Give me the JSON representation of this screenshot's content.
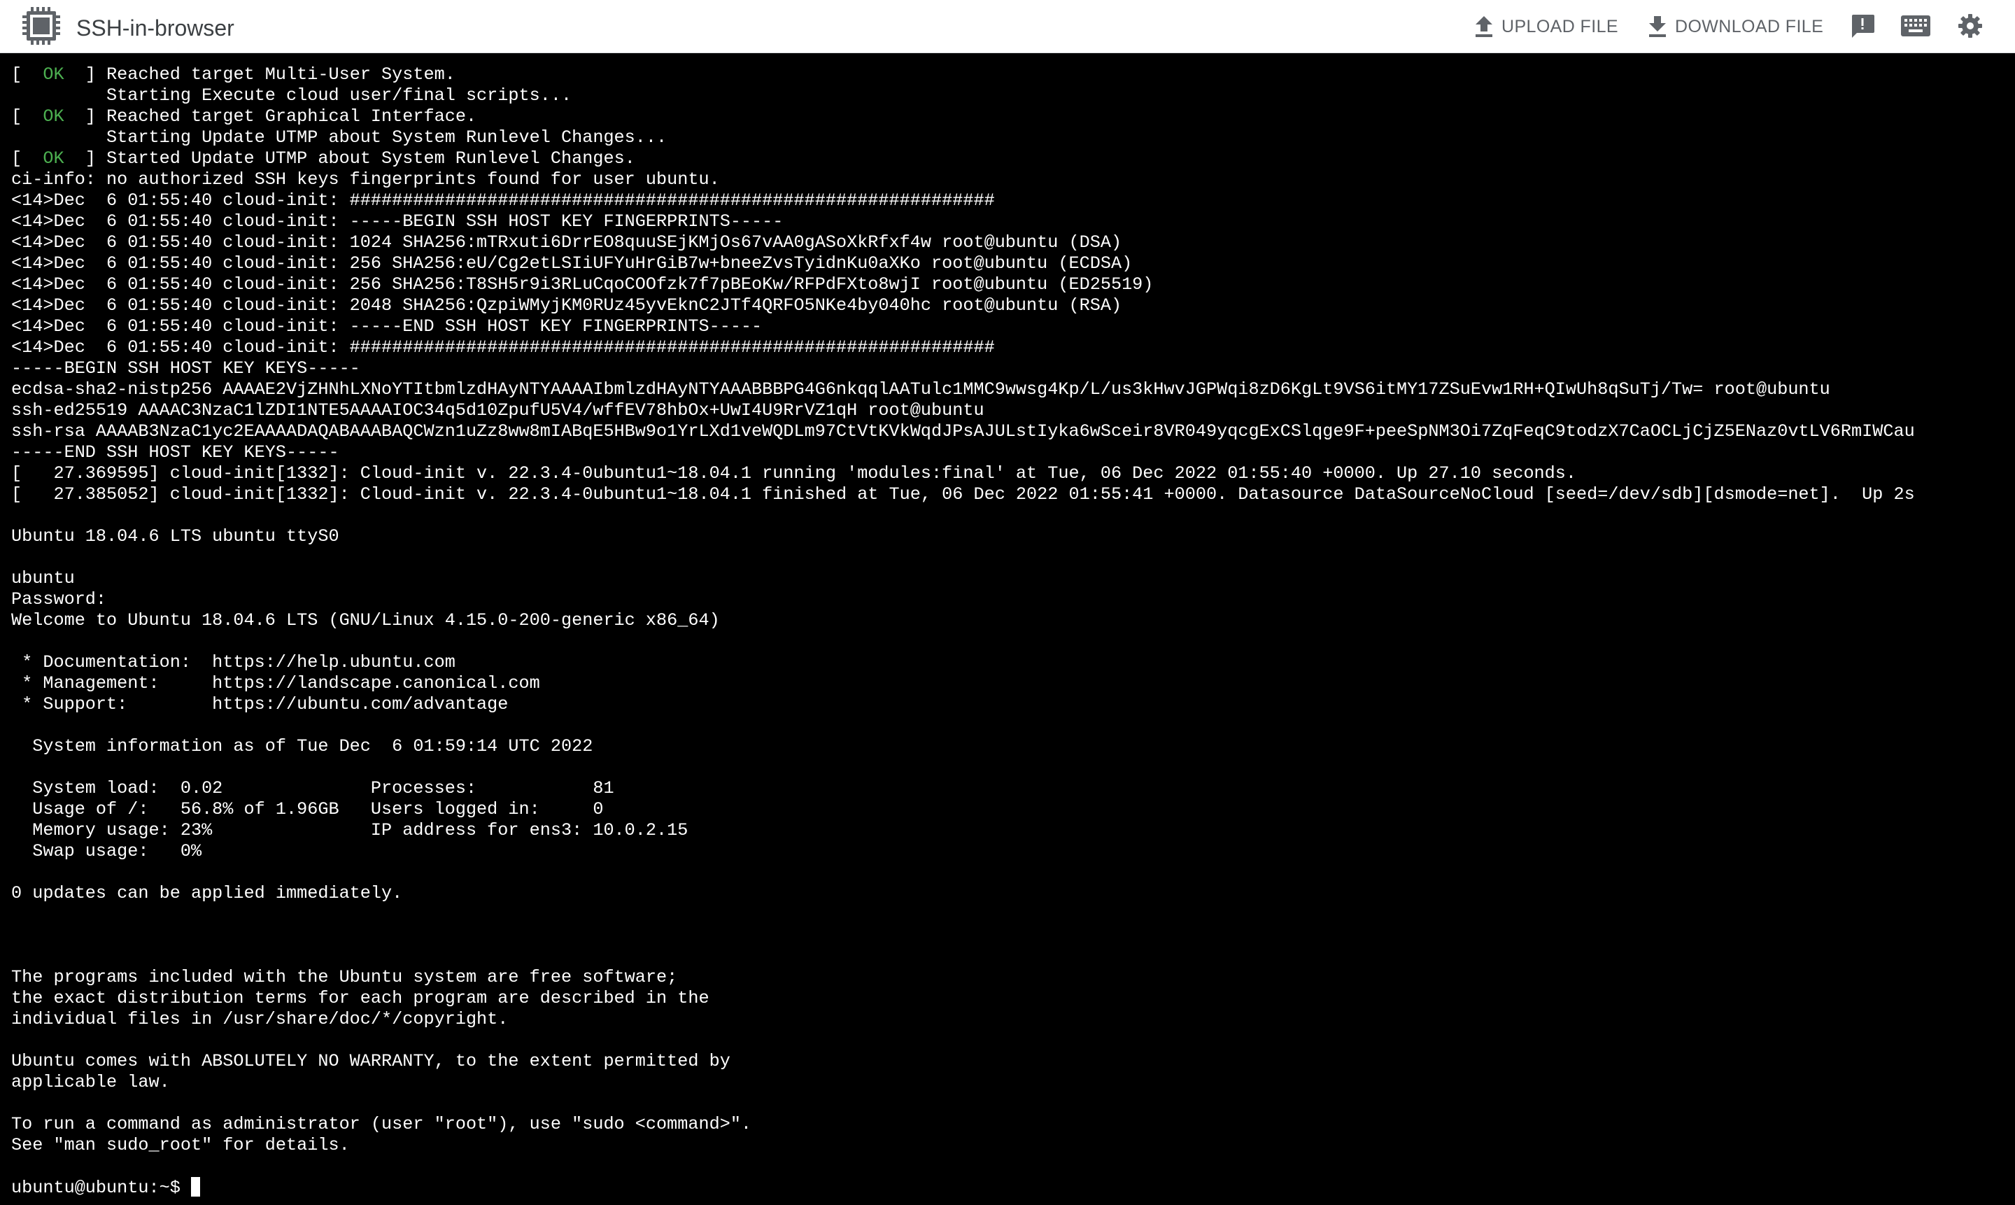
{
  "app": {
    "title": "SSH-in-browser"
  },
  "toolbar": {
    "upload_label": "UPLOAD FILE",
    "download_label": "DOWNLOAD FILE",
    "icons": {
      "logo": "chip-icon",
      "upload": "upload-icon",
      "download": "download-icon",
      "feedback": "feedback-icon",
      "keyboard": "keyboard-icon",
      "settings": "gear-icon"
    }
  },
  "colors": {
    "terminal_background": "#000000",
    "terminal_text": "#ffffff",
    "ok_status": "#4caf50",
    "toolbar_background": "#ffffff",
    "toolbar_text": "#5f6368"
  },
  "terminal": {
    "lines": [
      {
        "ok": true,
        "text": "Reached target Multi-User System."
      },
      {
        "text": "         Starting Execute cloud user/final scripts..."
      },
      {
        "ok": true,
        "text": "Reached target Graphical Interface."
      },
      {
        "text": "         Starting Update UTMP about System Runlevel Changes..."
      },
      {
        "ok": true,
        "text": "Started Update UTMP about System Runlevel Changes."
      },
      {
        "text": "ci-info: no authorized SSH keys fingerprints found for user ubuntu."
      },
      {
        "text": "<14>Dec  6 01:55:40 cloud-init: #############################################################"
      },
      {
        "text": "<14>Dec  6 01:55:40 cloud-init: -----BEGIN SSH HOST KEY FINGERPRINTS-----"
      },
      {
        "text": "<14>Dec  6 01:55:40 cloud-init: 1024 SHA256:mTRxuti6DrrEO8quuSEjKMjOs67vAA0gASoXkRfxf4w root@ubuntu (DSA)"
      },
      {
        "text": "<14>Dec  6 01:55:40 cloud-init: 256 SHA256:eU/Cg2etLSIiUFYuHrGiB7w+bneeZvsTyidnKu0aXKo root@ubuntu (ECDSA)"
      },
      {
        "text": "<14>Dec  6 01:55:40 cloud-init: 256 SHA256:T8SH5r9i3RLuCqoCOOfzk7f7pBEoKw/RFPdFXto8wjI root@ubuntu (ED25519)"
      },
      {
        "text": "<14>Dec  6 01:55:40 cloud-init: 2048 SHA256:QzpiWMyjKM0RUz45yvEknC2JTf4QRFO5NKe4by040hc root@ubuntu (RSA)"
      },
      {
        "text": "<14>Dec  6 01:55:40 cloud-init: -----END SSH HOST KEY FINGERPRINTS-----"
      },
      {
        "text": "<14>Dec  6 01:55:40 cloud-init: #############################################################"
      },
      {
        "text": "-----BEGIN SSH HOST KEY KEYS-----"
      },
      {
        "text": "ecdsa-sha2-nistp256 AAAAE2VjZHNhLXNoYTItbmlzdHAyNTYAAAAIbmlzdHAyNTYAAABBBPG4G6nkqqlAATulc1MMC9wwsg4Kp/L/us3kHwvJGPWqi8zD6KgLt9VS6itMY17ZSuEvw1RH+QIwUh8qSuTj/Tw= root@ubuntu"
      },
      {
        "text": "ssh-ed25519 AAAAC3NzaC1lZDI1NTE5AAAAIOC34q5d10ZpufU5V4/wffEV78hbOx+UwI4U9RrVZ1qH root@ubuntu"
      },
      {
        "text": "ssh-rsa AAAAB3NzaC1yc2EAAAADAQABAAABAQCWzn1uZz8ww8mIABqE5HBw9o1YrLXd1veWQDLm97CtVtKVkWqdJPsAJULstIyka6wSceir8VR049yqcgExCSlqge9F+peeSpNM3Oi7ZqFeqC9todzX7CaOCLjCjZ5ENaz0vtLV6RmIWCau"
      },
      {
        "text": "-----END SSH HOST KEY KEYS-----"
      },
      {
        "text": "[   27.369595] cloud-init[1332]: Cloud-init v. 22.3.4-0ubuntu1~18.04.1 running 'modules:final' at Tue, 06 Dec 2022 01:55:40 +0000. Up 27.10 seconds."
      },
      {
        "text": "[   27.385052] cloud-init[1332]: Cloud-init v. 22.3.4-0ubuntu1~18.04.1 finished at Tue, 06 Dec 2022 01:55:41 +0000. Datasource DataSourceNoCloud [seed=/dev/sdb][dsmode=net].  Up 2s"
      },
      {
        "text": ""
      },
      {
        "text": "Ubuntu 18.04.6 LTS ubuntu ttyS0"
      },
      {
        "text": ""
      },
      {
        "text": "ubuntu"
      },
      {
        "text": "Password:"
      },
      {
        "text": "Welcome to Ubuntu 18.04.6 LTS (GNU/Linux 4.15.0-200-generic x86_64)"
      },
      {
        "text": ""
      },
      {
        "text": " * Documentation:  https://help.ubuntu.com"
      },
      {
        "text": " * Management:     https://landscape.canonical.com"
      },
      {
        "text": " * Support:        https://ubuntu.com/advantage"
      },
      {
        "text": ""
      },
      {
        "text": "  System information as of Tue Dec  6 01:59:14 UTC 2022"
      },
      {
        "text": ""
      },
      {
        "text": "  System load:  0.02              Processes:           81"
      },
      {
        "text": "  Usage of /:   56.8% of 1.96GB   Users logged in:     0"
      },
      {
        "text": "  Memory usage: 23%               IP address for ens3: 10.0.2.15"
      },
      {
        "text": "  Swap usage:   0%"
      },
      {
        "text": ""
      },
      {
        "text": "0 updates can be applied immediately."
      },
      {
        "text": ""
      },
      {
        "text": ""
      },
      {
        "text": ""
      },
      {
        "text": "The programs included with the Ubuntu system are free software;"
      },
      {
        "text": "the exact distribution terms for each program are described in the"
      },
      {
        "text": "individual files in /usr/share/doc/*/copyright."
      },
      {
        "text": ""
      },
      {
        "text": "Ubuntu comes with ABSOLUTELY NO WARRANTY, to the extent permitted by"
      },
      {
        "text": "applicable law."
      },
      {
        "text": ""
      },
      {
        "text": "To run a command as administrator (user \"root\"), use \"sudo <command>\"."
      },
      {
        "text": "See \"man sudo_root\" for details."
      },
      {
        "text": ""
      }
    ],
    "ok_label": "OK",
    "prompt": "ubuntu@ubuntu:~$ "
  }
}
